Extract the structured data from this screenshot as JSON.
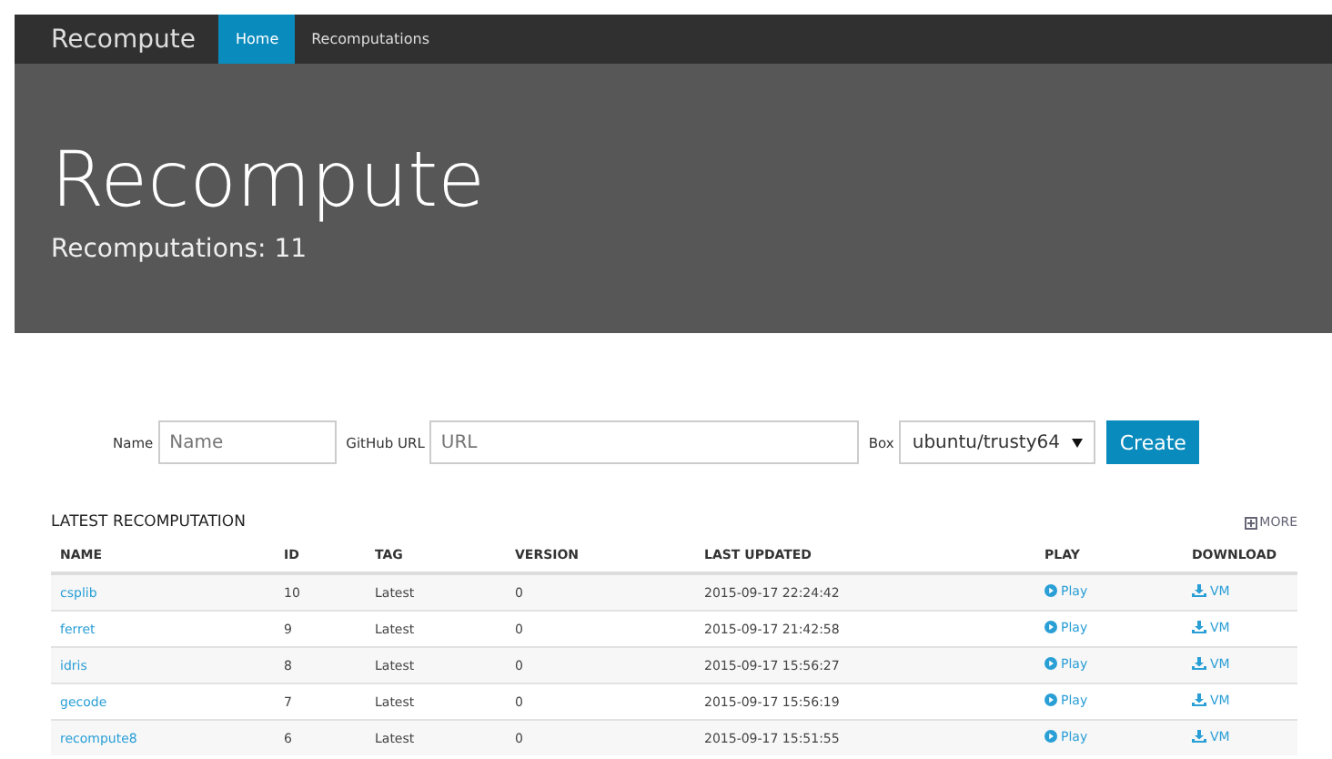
{
  "navbar": {
    "brand": "Recompute",
    "items": [
      {
        "label": "Home",
        "selected": true
      },
      {
        "label": "Recomputations",
        "selected": false
      }
    ]
  },
  "hero": {
    "title": "Recompute",
    "subtitle": "Recomputations: 11"
  },
  "form": {
    "name_label": "Name",
    "name_placeholder": "Name",
    "url_label": "GitHub URL",
    "url_placeholder": "URL",
    "box_label": "Box",
    "box_value": "ubuntu/trusty64",
    "button": "Create"
  },
  "table": {
    "title": "LATEST RECOMPUTATION",
    "more": "MORE",
    "columns": [
      "NAME",
      "ID",
      "TAG",
      "VERSION",
      "LAST UPDATED",
      "PLAY",
      "DOWNLOAD"
    ],
    "rows": [
      {
        "name": "csplib",
        "id": "10",
        "tag": "Latest",
        "version": "0",
        "updated": "2015-09-17 22:24:42",
        "play": "Play",
        "download": "VM"
      },
      {
        "name": "ferret",
        "id": "9",
        "tag": "Latest",
        "version": "0",
        "updated": "2015-09-17 21:42:58",
        "play": "Play",
        "download": "VM"
      },
      {
        "name": "idris",
        "id": "8",
        "tag": "Latest",
        "version": "0",
        "updated": "2015-09-17 15:56:27",
        "play": "Play",
        "download": "VM"
      },
      {
        "name": "gecode",
        "id": "7",
        "tag": "Latest",
        "version": "0",
        "updated": "2015-09-17 15:56:19",
        "play": "Play",
        "download": "VM"
      },
      {
        "name": "recompute8",
        "id": "6",
        "tag": "Latest",
        "version": "0",
        "updated": "2015-09-17 15:51:55",
        "play": "Play",
        "download": "VM"
      }
    ]
  }
}
